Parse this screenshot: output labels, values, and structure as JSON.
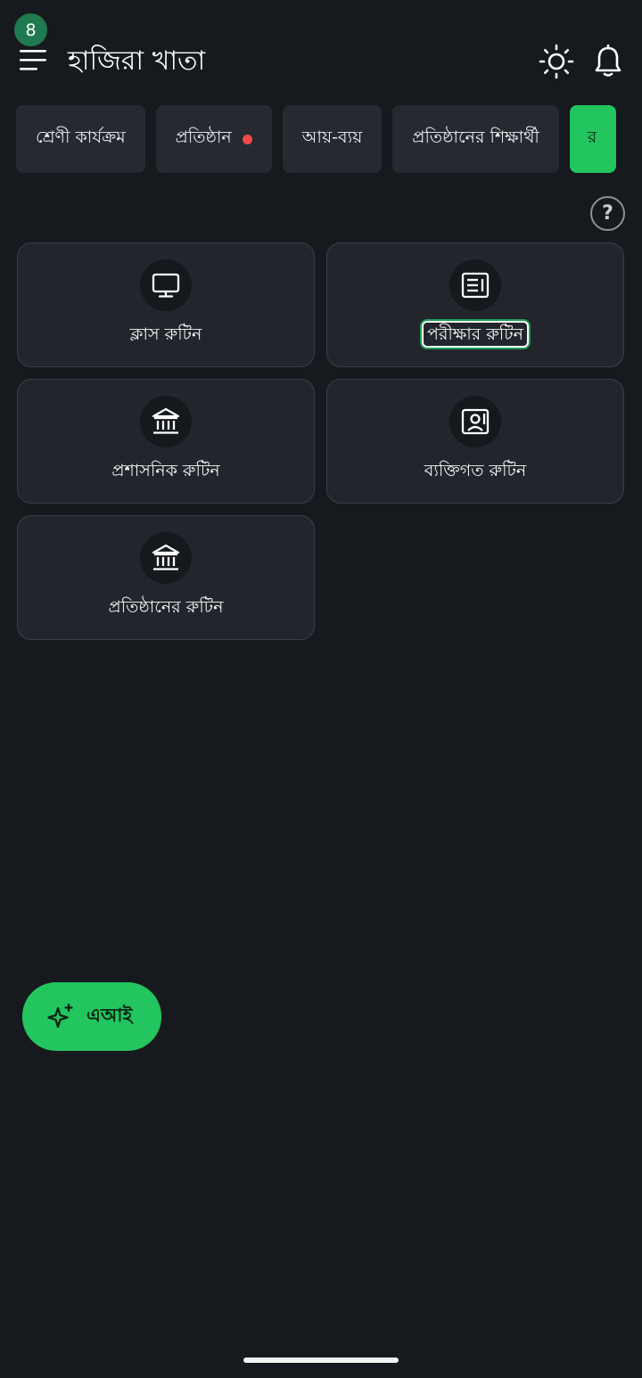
{
  "header": {
    "badge_count": "8",
    "title": "হাজিরা খাতা",
    "icons": [
      "menu-icon",
      "sun-icon",
      "bell-icon"
    ]
  },
  "tabs": [
    {
      "label": "শ্রেণী কার্যক্রম",
      "dot": false
    },
    {
      "label": "প্রতিষ্ঠান",
      "dot": true
    },
    {
      "label": "আয়-ব্যয়",
      "dot": false
    },
    {
      "label": "প্রতিষ্ঠানের শিক্ষার্থী",
      "dot": false
    },
    {
      "label": "র",
      "dot": false,
      "active": true
    }
  ],
  "help": {
    "label": "?"
  },
  "cards": [
    {
      "label": "ক্লাস রুটিন",
      "icon": "monitor-icon"
    },
    {
      "label": "পরীক্ষার রুটিন",
      "icon": "document-icon",
      "focused": true
    },
    {
      "label": "প্রশাসনিক রুটিন",
      "icon": "institution-icon"
    },
    {
      "label": "ব্যক্তিগত রুটিন",
      "icon": "contact-card-icon"
    },
    {
      "label": "প্রতিষ্ঠানের রুটিন",
      "icon": "institution-icon"
    }
  ],
  "ai_button": {
    "label": "এআই",
    "icon": "sparkle-icon"
  },
  "colors": {
    "background": "#16191d",
    "card": "#22262c",
    "accent_green": "#22c55e",
    "badge_green": "#1f7a4f",
    "alert_dot": "#f04a4a"
  }
}
